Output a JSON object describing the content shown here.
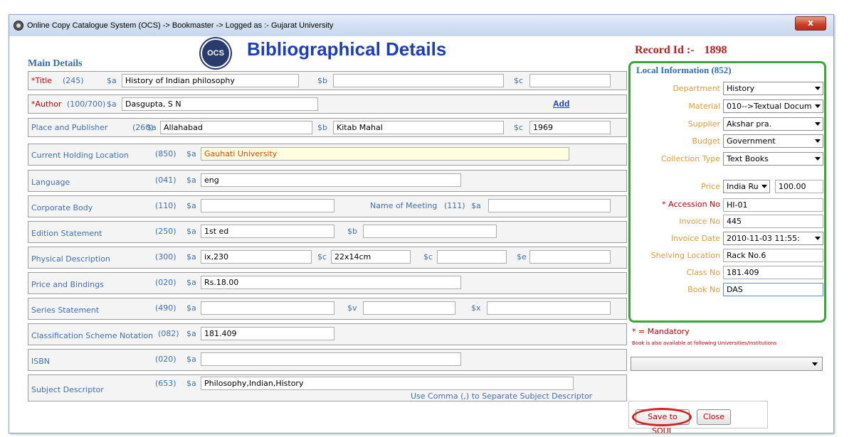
{
  "window": {
    "title": "Online Copy Catalogue System (OCS) -> Bookmaster -> Logged as :- Gujarat University",
    "close_glyph": "x"
  },
  "header": {
    "logo_text": "OCS",
    "title": "Bibliographical Details",
    "record_label": "Record Id :-",
    "record_id": "1898"
  },
  "main": {
    "section_label": "Main Details",
    "title_row": {
      "label": "*Title",
      "tag": "(245)",
      "sa": "$a",
      "sa_value": "History of Indian philosophy",
      "sb": "$b",
      "sb_value": "",
      "sc": "$c",
      "sc_value": ""
    },
    "author_row": {
      "label": "*Author",
      "tag": "(100/700)",
      "sa": "$a",
      "sa_value": "Dasgupta, S N",
      "add_label": "Add"
    },
    "publisher_row": {
      "label": "Place and Publisher",
      "tag": "(260)",
      "sa": "$a",
      "sa_value": "Allahabad",
      "sb": "$b",
      "sb_value": "Kitab Mahal",
      "sc": "$c",
      "sc_value": "1969"
    },
    "holding_row": {
      "label": "Current Holding Location",
      "tag": "(850)",
      "sa": "$a",
      "sa_value": "Gauhati University"
    },
    "language_row": {
      "label": "Language",
      "tag": "(041)",
      "sa": "$a",
      "sa_value": "eng"
    },
    "corporate_row": {
      "label": "Corporate Body",
      "tag": "(110)",
      "sa": "$a",
      "sa_value": "",
      "meeting_label": "Name of Meeting",
      "meeting_tag": "(111)",
      "meeting_sa": "$a",
      "meeting_value": ""
    },
    "edition_row": {
      "label": "Edition Statement",
      "tag": "(250)",
      "sa": "$a",
      "sa_value": "1st ed",
      "sb": "$b",
      "sb_value": ""
    },
    "physical_row": {
      "label": "Physical Description",
      "tag": "(300)",
      "sa": "$a",
      "sa_value": "ix,230",
      "sc": "$c",
      "sc_value": "22x14cm",
      "sc2": "$c",
      "sc2_value": "",
      "se": "$e",
      "se_value": ""
    },
    "price_row": {
      "label": "Price and Bindings",
      "tag": "(020)",
      "sa": "$a",
      "sa_value": "Rs.18.00"
    },
    "series_row": {
      "label": "Series Statement",
      "tag": "(490)",
      "sa": "$a",
      "sa_value": "",
      "sv": "$v",
      "sv_value": "",
      "sx": "$x",
      "sx_value": ""
    },
    "classification_row": {
      "label": "Classification Scheme Notation",
      "tag": "(082)",
      "sa": "$a",
      "sa_value": "181.409"
    },
    "isbn_row": {
      "label": "ISBN",
      "tag": "(020)",
      "sa": "$a",
      "sa_value": ""
    },
    "subject_row": {
      "label": "Subject Descriptor",
      "tag": "(653)",
      "sa": "$a",
      "sa_value": "Philosophy,Indian,History",
      "hint": "Use Comma (,) to Separate Subject Descriptor"
    }
  },
  "local": {
    "title": "Local Information (852)",
    "department": {
      "label": "Department",
      "value": "History"
    },
    "material": {
      "label": "Material",
      "value": "010-->Textual Docum"
    },
    "supplier": {
      "label": "Supplier",
      "value": "Akshar pra."
    },
    "budget": {
      "label": "Budget",
      "value": "Government"
    },
    "collection_type": {
      "label": "Collection Type",
      "value": "Text Books"
    },
    "price": {
      "label": "Price",
      "currency": "India Ru",
      "value": "100.00"
    },
    "accession_no": {
      "label": "* Accession No",
      "value": "HI-01"
    },
    "invoice_no": {
      "label": "Invoice No",
      "value": "445"
    },
    "invoice_date": {
      "label": "Invoice Date",
      "value": "2010-11-03 11:55:"
    },
    "shelving_location": {
      "label": "Shelving Location",
      "value": "Rack No.6"
    },
    "class_no": {
      "label": "Class No",
      "value": "181.409"
    },
    "book_no": {
      "label": "Book No",
      "value": "DAS"
    }
  },
  "side": {
    "mandatory_note": "* = Mandatory",
    "availability_note": "Book is also available at following Universities/Institutions",
    "availability_value": ""
  },
  "buttons": {
    "save_label": "Save to SOUL",
    "close_label": "Close"
  },
  "colors": {
    "heading": "#1d3fb5",
    "label": "#3f6fb0",
    "required": "#c00000",
    "local_border": "#3aa63a",
    "right_label": "#e19a3c"
  }
}
